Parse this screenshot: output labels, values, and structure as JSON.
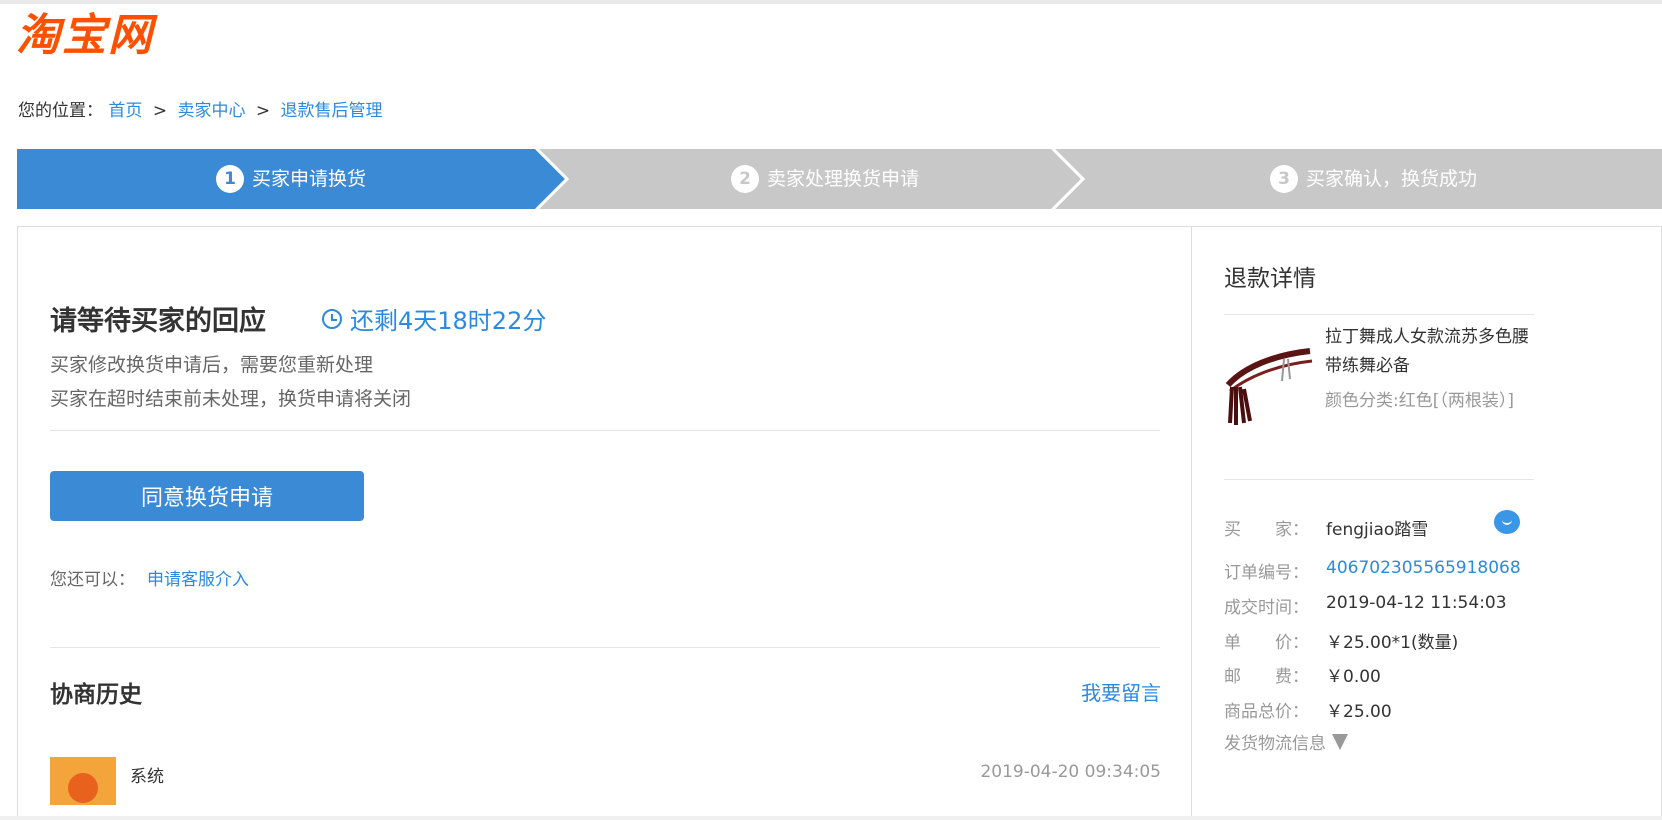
{
  "logo": {
    "text": "淘宝网"
  },
  "breadcrumb": {
    "prefix": "您的位置：",
    "items": [
      "首页",
      "卖家中心",
      "退款售后管理"
    ],
    "separator": ">"
  },
  "steps": [
    {
      "num": "1",
      "label": "买家申请换货",
      "active": true
    },
    {
      "num": "2",
      "label": "卖家处理换货申请",
      "active": false
    },
    {
      "num": "3",
      "label": "买家确认，换货成功",
      "active": false
    }
  ],
  "colors": {
    "active": "#3a8ad6",
    "inactive": "#c8c8c8",
    "link": "#2a8ae0",
    "brand": "#ff5000"
  },
  "main": {
    "title": "请等待买家的回应",
    "countdown": "还剩4天18时22分",
    "desc": [
      "买家修改换货申请后，需要您重新处理",
      "买家在超时结束前未处理，换货申请将关闭"
    ],
    "agree_button": "同意换货申请",
    "also_label": "您还可以：",
    "also_link": "申请客服介入",
    "history_title": "协商历史",
    "leave_message": "我要留言",
    "history": [
      {
        "name": "系统",
        "time": "2019-04-20 09:34:05"
      }
    ]
  },
  "detail": {
    "title": "退款详情",
    "product": {
      "name": "拉丁舞成人女款流苏多色腰带练舞必备",
      "sku": "颜色分类:红色[（两根装）]"
    },
    "rows": [
      {
        "key": "买　　家：",
        "value": "fengjiao踏雪",
        "link": false
      },
      {
        "key": "订单编号：",
        "value": "406702305565918068",
        "link": true
      },
      {
        "key": "成交时间：",
        "value": "2019-04-12 11:54:03",
        "link": false
      },
      {
        "key": "单　　价：",
        "value": "￥25.00*1(数量)",
        "link": false
      },
      {
        "key": "邮　　费：",
        "value": "￥0.00",
        "link": false
      },
      {
        "key": "商品总价：",
        "value": "￥25.00",
        "link": false
      }
    ],
    "shipping_toggle": "发货物流信息"
  }
}
